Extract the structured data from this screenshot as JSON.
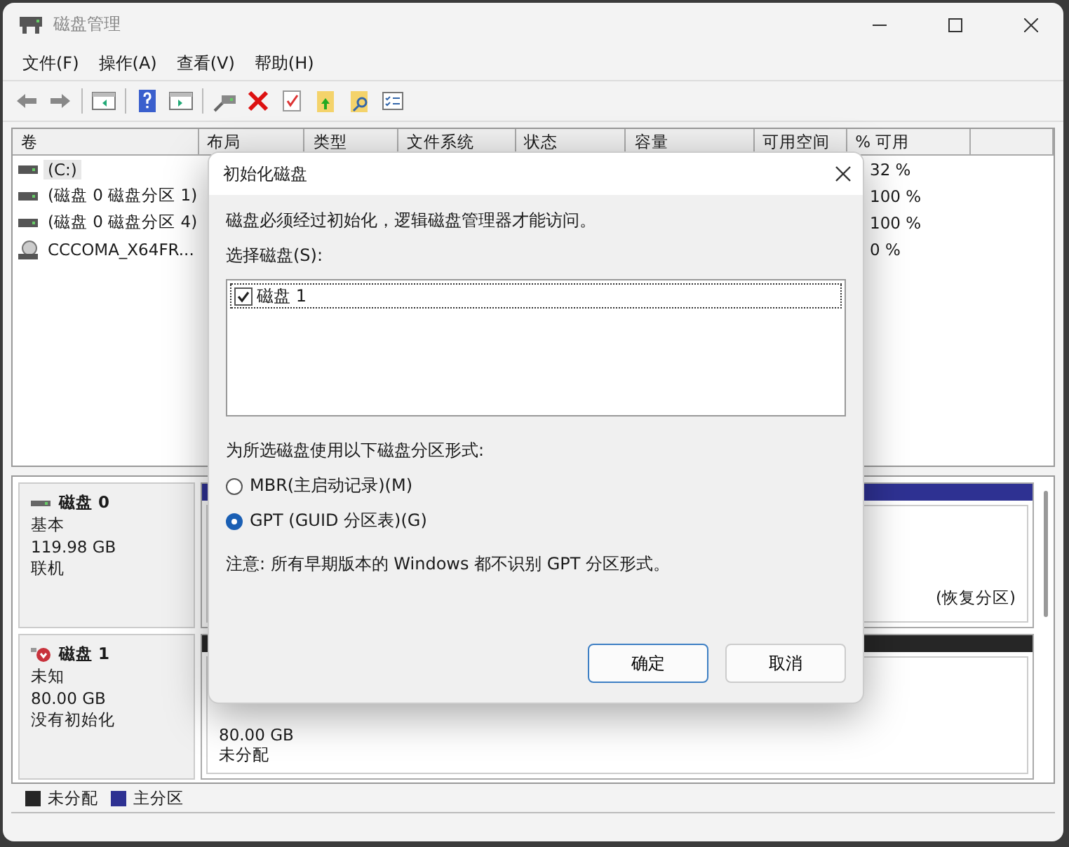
{
  "window": {
    "title": "磁盘管理"
  },
  "menu": [
    {
      "label": "文件(F)"
    },
    {
      "label": "操作(A)"
    },
    {
      "label": "查看(V)"
    },
    {
      "label": "帮助(H)"
    }
  ],
  "volume_table": {
    "columns": [
      "卷",
      "布局",
      "类型",
      "文件系统",
      "状态",
      "容量",
      "可用空间",
      "% 可用"
    ],
    "rows": [
      {
        "kind": "drive",
        "volume": "(C:)",
        "percent_free": "32 %",
        "selected": true
      },
      {
        "kind": "drive",
        "volume": "(磁盘 0 磁盘分区 1)",
        "percent_free": "100 %",
        "selected": false
      },
      {
        "kind": "drive",
        "volume": "(磁盘 0 磁盘分区 4)",
        "percent_free": "100 %",
        "selected": false
      },
      {
        "kind": "cdrom",
        "volume": "CCCOMA_X64FR...",
        "percent_free": "0 %",
        "selected": false
      }
    ]
  },
  "disks": [
    {
      "kind": "online",
      "name": "磁盘 0",
      "type": "基本",
      "size": "119.98 GB",
      "status": "联机",
      "partitions": [
        {
          "color": "#2e3192",
          "lines": [
            "(恢复分区)"
          ]
        }
      ]
    },
    {
      "kind": "error",
      "name": "磁盘 1",
      "type": "未知",
      "size": "80.00 GB",
      "status": "没有初始化",
      "partitions": [
        {
          "color": "#262626",
          "lines": [
            "80.00 GB",
            "未分配"
          ]
        }
      ]
    }
  ],
  "legend": [
    {
      "label": "未分配",
      "color": "#262626"
    },
    {
      "label": "主分区",
      "color": "#2e3192"
    }
  ],
  "dialog": {
    "title": "初始化磁盘",
    "message": "磁盘必须经过初始化，逻辑磁盘管理器才能访问。",
    "select_label": "选择磁盘(S):",
    "disks": [
      {
        "label": "磁盘 1",
        "checked": true,
        "selected": true
      }
    ],
    "style_label": "为所选磁盘使用以下磁盘分区形式:",
    "options": [
      {
        "label": "MBR(主启动记录)(M)",
        "selected": false
      },
      {
        "label": "GPT (GUID 分区表)(G)",
        "selected": true
      }
    ],
    "note": "注意: 所有早期版本的 Windows 都不识别 GPT 分区形式。",
    "buttons": [
      {
        "label": "确定",
        "default": true
      },
      {
        "label": "取消",
        "default": false
      }
    ]
  }
}
